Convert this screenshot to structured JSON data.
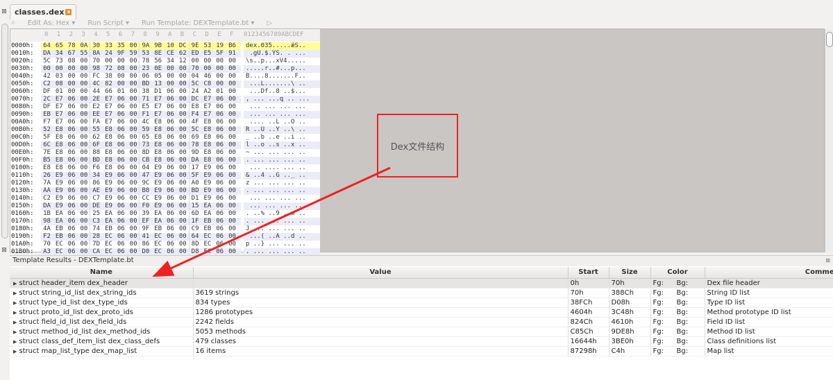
{
  "tab": {
    "label": "classes.dex"
  },
  "toolbar": {
    "edit_as": "Edit As: Hex ▾",
    "run_script": "Run Script ▾",
    "run_template": "Run Template: DEXTemplate.bt ▾"
  },
  "hex": {
    "column_header_hex": [
      "0",
      "1",
      "2",
      "3",
      "4",
      "5",
      "6",
      "7",
      "8",
      "9",
      "A",
      "B",
      "C",
      "D",
      "E",
      "F"
    ],
    "column_header_ascii": "0123456789ABCDEF",
    "rows": [
      {
        "offset": "0000h:",
        "bytes": "64 65 78 0A 30 33 35 00 9A 9B 10 DC 9E 53 19 B6",
        "ascii": "dex.035.....ǽS.."
      },
      {
        "offset": "0010h:",
        "bytes": "DA 34 67 55 8A 24 9F 59 53 8E CE 62 ED E5 5F 91",
        "ascii": " .gU.$.YS. . ..."
      },
      {
        "offset": "0020h:",
        "bytes": "5C 73 08 00 70 00 00 00 78 56 34 12 00 00 00 00",
        "ascii": "\\s..p...xV4....."
      },
      {
        "offset": "0030h:",
        "bytes": "00 00 00 00 98 72 08 00 23 0E 00 00 70 00 00 00",
        "ascii": ".....r..#...p..."
      },
      {
        "offset": "0040h:",
        "bytes": "42 03 00 00 FC 38 00 00 06 05 00 00 04 46 00 00",
        "ascii": "B....8.......F.."
      },
      {
        "offset": "0050h:",
        "bytes": "C2 08 00 00 4C 82 00 00 BD 13 00 00 5C C8 00 00",
        "ascii": " ...L.......\\ .."
      },
      {
        "offset": "0060h:",
        "bytes": "DF 01 00 00 44 66 01 00 38 D1 06 00 24 A2 01 00",
        "ascii": " ...Df..8 ..$..."
      },
      {
        "offset": "0070h:",
        "bytes": "2C E7 06 00 2E E7 06 00 71 E7 06 00 DC E7 06 00",
        "ascii": ", ... ...q .. ..."
      },
      {
        "offset": "0080h:",
        "bytes": "DF E7 06 00 E2 E7 06 00 E5 E7 06 00 E8 E7 06 00",
        "ascii": " ... ... ... ..."
      },
      {
        "offset": "0090h:",
        "bytes": "EB E7 06 00 EE E7 06 00 F1 E7 06 00 F4 E7 06 00",
        "ascii": " ... ... ... ..."
      },
      {
        "offset": "00A0h:",
        "bytes": "F7 E7 06 00 FA E7 06 00 4C E8 06 00 4F E8 06 00",
        "ascii": " .... ..L ..O .."
      },
      {
        "offset": "00B0h:",
        "bytes": "52 E8 06 00 55 E8 06 00 59 E8 06 00 5C E8 06 00",
        "ascii": "R ..U ..Y ..\\ .."
      },
      {
        "offset": "00C0h:",
        "bytes": "5F E8 06 00 62 E8 06 00 65 E8 06 00 69 E8 06 00",
        "ascii": "_ ..b ..e ..i .."
      },
      {
        "offset": "00D0h:",
        "bytes": "6C E8 06 00 6F E8 06 00 73 E8 06 00 78 E8 06 00",
        "ascii": "l ..o ..s ..x .."
      },
      {
        "offset": "00E0h:",
        "bytes": "7E E8 06 00 88 E8 06 00 8D E8 06 00 9D E8 06 00",
        "ascii": "~ ... ... ... .."
      },
      {
        "offset": "00F0h:",
        "bytes": "B5 E8 06 00 BD E8 06 00 CB E8 06 00 DA E8 06 00",
        "ascii": ". ... ... ... .."
      },
      {
        "offset": "0100h:",
        "bytes": "E8 E8 06 00 F6 E8 06 00 04 E9 06 00 17 E9 06 00",
        "ascii": " ... .... ... .."
      },
      {
        "offset": "0110h:",
        "bytes": "26 E9 06 00 34 E9 06 00 47 E9 06 00 5F E9 06 00",
        "ascii": "& ..4 ..G .._ .."
      },
      {
        "offset": "0120h:",
        "bytes": "7A E9 06 00 86 E9 06 00 9C E9 06 00 A0 E9 06 00",
        "ascii": "z ... ... ... .."
      },
      {
        "offset": "0130h:",
        "bytes": "AA E9 06 00 AE E9 06 00 B8 E9 06 00 BD E9 06 00",
        "ascii": ". ... ... ... .."
      },
      {
        "offset": "0140h:",
        "bytes": "C2 E9 06 00 C7 E9 06 00 CC E9 06 00 D1 E9 06 00",
        "ascii": " ... ... ... ..."
      },
      {
        "offset": "0150h:",
        "bytes": "DA E9 06 00 DE E9 06 00 F0 E9 06 00 15 EA 06 00",
        "ascii": " ... ... ... ..."
      },
      {
        "offset": "0160h:",
        "bytes": "1B EA 06 00 25 EA 06 00 39 EA 06 00 6D EA 06 00",
        "ascii": ". ..% ..9 ..m .."
      },
      {
        "offset": "0170h:",
        "bytes": "98 EA 06 00 C3 EA 06 00 EF EA 06 00 1F EB 06 00",
        "ascii": ". ... ... ... .."
      },
      {
        "offset": "0180h:",
        "bytes": "4A EB 06 00 74 EB 06 00 9F EB 06 00 C9 EB 06 00",
        "ascii": "J ... ... ... .."
      },
      {
        "offset": "0190h:",
        "bytes": "F2 EB 06 00 28 EC 06 00 41 EC 06 00 64 EC 06 00",
        "ascii": " ...( ..A ..d .."
      },
      {
        "offset": "01A0h:",
        "bytes": "70 EC 06 00 7D EC 06 00 86 EC 06 00 8D EC 06 00",
        "ascii": "p ..} ... ... .."
      },
      {
        "offset": "01B0h:",
        "bytes": "A3 EC 06 00 CA EC 06 00 D0 EC 06 00 D8 EC 06 00",
        "ascii": ". ... ... ... .."
      }
    ]
  },
  "template": {
    "title": "Template Results - DEXTemplate.bt",
    "columns": [
      "Name",
      "Value",
      "Start",
      "Size",
      "Color",
      "Comment"
    ],
    "rows": [
      {
        "name": "struct header_item dex_header",
        "value": "",
        "start": "0h",
        "size": "70h",
        "fg": "Fg:",
        "bg": "Bg:",
        "comment": "Dex file header"
      },
      {
        "name": "struct string_id_list dex_string_ids",
        "value": "3619 strings",
        "start": "70h",
        "size": "388Ch",
        "fg": "Fg:",
        "bg": "Bg:",
        "comment": "String ID list"
      },
      {
        "name": "struct type_id_list dex_type_ids",
        "value": "834 types",
        "start": "38FCh",
        "size": "D08h",
        "fg": "Fg:",
        "bg": "Bg:",
        "comment": "Type ID list"
      },
      {
        "name": "struct proto_id_list dex_proto_ids",
        "value": "1286 prototypes",
        "start": "4604h",
        "size": "3C48h",
        "fg": "Fg:",
        "bg": "Bg:",
        "comment": "Method prototype ID list"
      },
      {
        "name": "struct field_id_list dex_field_ids",
        "value": "2242 fields",
        "start": "824Ch",
        "size": "4610h",
        "fg": "Fg:",
        "bg": "Bg:",
        "comment": "Field ID list"
      },
      {
        "name": "struct method_id_list dex_method_ids",
        "value": "5053 methods",
        "start": "C85Ch",
        "size": "9DE8h",
        "fg": "Fg:",
        "bg": "Bg:",
        "comment": "Method ID list"
      },
      {
        "name": "struct class_def_item_list dex_class_defs",
        "value": "479 classes",
        "start": "16644h",
        "size": "3BE0h",
        "fg": "Fg:",
        "bg": "Bg:",
        "comment": "Class definitions list"
      },
      {
        "name": "struct map_list_type dex_map_list",
        "value": "16 items",
        "start": "87298h",
        "size": "C4h",
        "fg": "Fg:",
        "bg": "Bg:",
        "comment": "Map list"
      }
    ]
  },
  "annotation": {
    "label": "Dex文件结构",
    "color": "#ee2222"
  },
  "colors": {
    "highlight": "#ffff99",
    "alt_row": "#ececf8",
    "empty_area": "#c9c6c3"
  }
}
